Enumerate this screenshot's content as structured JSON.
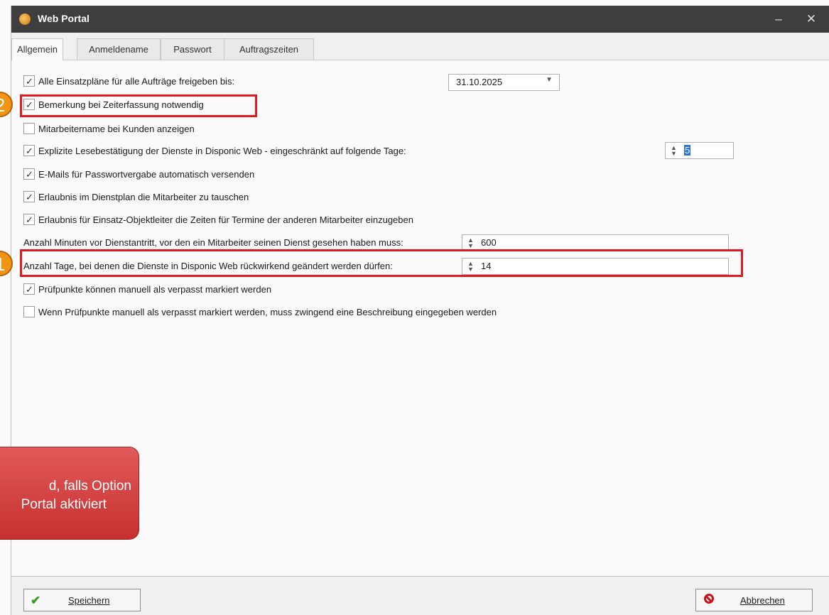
{
  "window": {
    "title": "Web Portal",
    "minimize": "–",
    "close": "✕"
  },
  "tabs": [
    "Allgemein",
    "Anmeldename",
    "Passwort",
    "Auftragszeiten"
  ],
  "options": {
    "release_plans": {
      "label": "Alle Einsatzpläne für alle Aufträge freigeben bis:",
      "checked": true,
      "date": "31.10.2025"
    },
    "remark_required": {
      "label": "Bemerkung bei Zeiterfassung notwendig",
      "checked": true
    },
    "show_employee_name": {
      "label": "Mitarbeitername bei Kunden anzeigen",
      "checked": false
    },
    "read_confirmation": {
      "label": "Explizite Lesebestätigung der Dienste in Disponic Web - eingeschränkt auf folgende Tage:",
      "checked": true,
      "days": "5"
    },
    "send_password_emails": {
      "label": "E-Mails für Passwortvergabe automatisch versenden",
      "checked": true
    },
    "allow_swap": {
      "label": "Erlaubnis im Dienstplan die Mitarbeiter zu tauschen",
      "checked": true
    },
    "allow_object_leader": {
      "label": "Erlaubnis für  Einsatz-Objektleiter die Zeiten für Termine der anderen Mitarbeiter einzugeben",
      "checked": true
    },
    "minutes_before_shift": {
      "label": "Anzahl Minuten vor Dienstantritt,  vor den ein Mitarbeiter seinen Dienst gesehen haben muss:",
      "value": "600"
    },
    "days_retroactive": {
      "label": "Anzahl Tage, bei denen die Dienste in Disponic Web rückwirkend geändert werden dürfen:",
      "value": "14"
    },
    "checkpoints_missed": {
      "label": "Prüfpunkte können manuell als verpasst markiert werden",
      "checked": true
    },
    "checkpoints_description": {
      "label": "Wenn Prüfpunkte manuell als verpasst markiert werden, muss zwingend eine Beschreibung eingegeben werden",
      "checked": false
    }
  },
  "annotations": {
    "badge_1": "1",
    "badge_2": "2"
  },
  "tooltip": {
    "line1": "d, falls Option",
    "line2": "Portal aktiviert"
  },
  "buttons": {
    "save": "Speichern",
    "cancel": "Abbrechen"
  },
  "colors": {
    "highlight": "#e01a1f",
    "badge": "#f29514",
    "titlebar": "#3e3e3e",
    "tooltip": "#d24242"
  },
  "icons": {
    "app": "app-logo-icon",
    "check": "check-icon",
    "cancel": "cancel-icon"
  }
}
